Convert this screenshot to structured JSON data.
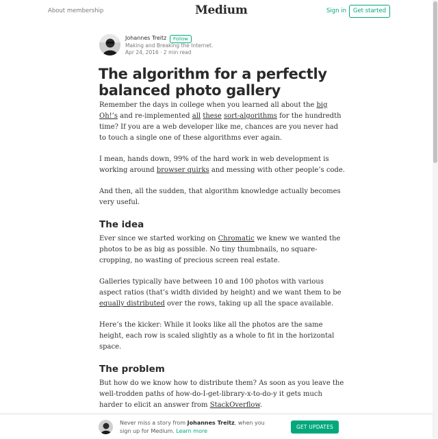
{
  "nav": {
    "about": "About membership",
    "logo": "Medium",
    "signin": "Sign in",
    "get_started": "Get started"
  },
  "author": {
    "name": "Johannes Treitz",
    "follow": "Follow",
    "bio": "Making and Breaking the Internet.",
    "meta": "Apr 24, 2016 · 2 min read"
  },
  "article": {
    "title": "The algorithm for a perfectly balanced photo gallery",
    "p1": {
      "a": "Remember the days in college when you learned all about the ",
      "l1": "big Oh!’s",
      "b": " and re-implemented ",
      "l2": "all",
      "c": " ",
      "l3": "these",
      "d": " ",
      "l4": "sort-algorithms",
      "e": " for the hundredth time? If you are a web developer like me, chances are you never had to touch a single one of these algorithms ever again."
    },
    "p2": {
      "a": "I mean, hands down, 99% of the hard work in web development is working around ",
      "l1": "browser quirks",
      "b": " and messing with other people’s code."
    },
    "p3": "And then, all the sudden, that algorithm knowledge actually becomes very useful.",
    "h_idea": "The idea",
    "p4": {
      "a": "Ever since we started working on ",
      "l1": "Chromatic",
      "b": " we knew we wanted the photos to be as big as possible. No tiny thumbnails, no square-cropping, no wasting of precious screen real estate."
    },
    "p5": {
      "a": "Galleries typically have between 10 and 100 photos with various aspect ratios (that’s width divided by height) and we want them to be ",
      "l1": "equally distributed",
      "b": " over the rows, taking up all the space available."
    },
    "p6": "Here’s the kicker: While it looks like all the photos are the same height, each row is scaled slightly as a whole to fit in the horizontal space.",
    "h_problem": "The problem",
    "p7": {
      "a": "But how do we know how to distribute them? As soon as you leave the well-trodden paths of how-do-I-get-library-x-to-do-y it gets much harder to elicit an answer from ",
      "l1": "StackOverflow",
      "b": "."
    }
  },
  "footer": {
    "pre": "Never miss a story from ",
    "name": "Johannes Treitz",
    "post": ", when you sign up for Medium. ",
    "learn": "Learn more",
    "button": "GET UPDATES"
  },
  "icons": {
    "avatar": "author-photo-icon",
    "footer_avatar": "author-photo-icon"
  },
  "colors": {
    "accent": "#03a87c",
    "text": "rgba(0,0,0,0.84)"
  }
}
